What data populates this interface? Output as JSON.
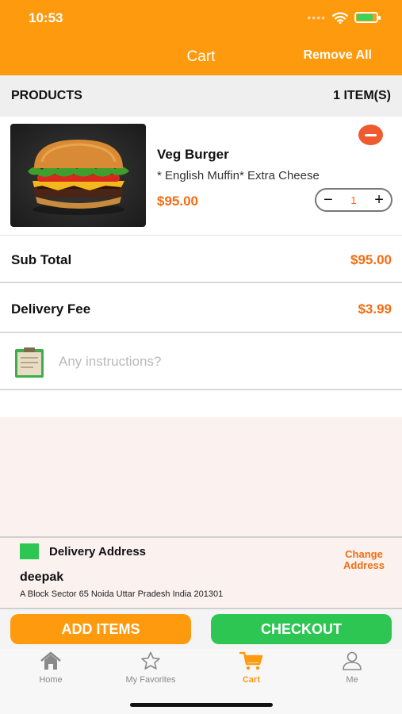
{
  "status_bar": {
    "time": "10:53"
  },
  "header": {
    "title": "Cart",
    "remove_all": "Remove All"
  },
  "products_bar": {
    "label": "PRODUCTS",
    "count": "1 ITEM(S)"
  },
  "product": {
    "name": "Veg Burger",
    "extras": "* English Muffin* Extra Cheese",
    "price": "$95.00",
    "quantity": "1",
    "minus": "−",
    "plus": "+"
  },
  "summary": {
    "subtotal_label": "Sub Total",
    "subtotal_value": "$95.00",
    "delivery_label": "Delivery Fee",
    "delivery_value": "$3.99"
  },
  "instructions": {
    "placeholder": "Any instructions?"
  },
  "address": {
    "title": "Delivery Address",
    "change_line1": "Change",
    "change_line2": "Address",
    "name": "deepak",
    "line": "A Block Sector 65 Noida Uttar Pradesh India 201301"
  },
  "actions": {
    "add_items": "ADD ITEMS",
    "checkout": "CHECKOUT"
  },
  "tabs": [
    {
      "label": "Home",
      "icon": "home-icon",
      "active": false
    },
    {
      "label": "My Favorites",
      "icon": "star-icon",
      "active": false
    },
    {
      "label": "Cart",
      "icon": "cart-icon",
      "active": true
    },
    {
      "label": "Me",
      "icon": "person-icon",
      "active": false
    }
  ],
  "colors": {
    "brand_orange": "#fe9a0d",
    "price_orange": "#f36d14",
    "checkout_green": "#2dc653",
    "remove_red": "#ef5a30"
  }
}
